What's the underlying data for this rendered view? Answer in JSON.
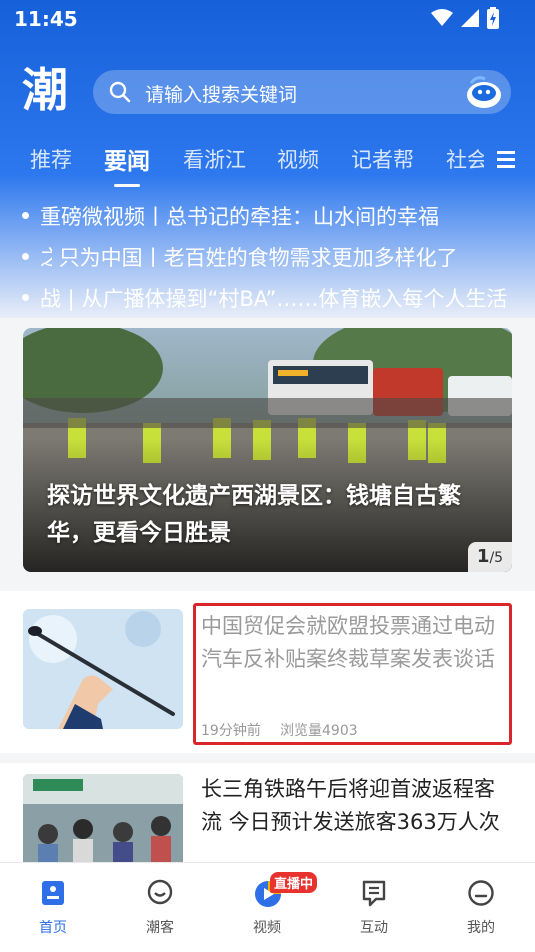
{
  "status": {
    "time": "11:45"
  },
  "header": {
    "logo_text": "潮",
    "search_placeholder": "请输入搜索关键词"
  },
  "tabs": [
    {
      "label": "推荐"
    },
    {
      "label": "要闻",
      "active": true
    },
    {
      "label": "看浙江"
    },
    {
      "label": "视频"
    },
    {
      "label": "记者帮"
    },
    {
      "label": "社会"
    }
  ],
  "headlines": [
    "重磅微视频丨总书记的牵挂：山水间的幸福",
    "只为中国丨老百姓的食物需求更加多样化了",
    "从广播体操到“村BA”……体育嵌入每个人生活"
  ],
  "headline_prefixes": [
    "",
    "之",
    "战 |"
  ],
  "banner": {
    "title": "探访世界文化遗产西湖景区：钱塘自古繁华，更看今日胜景",
    "page_current": "1",
    "page_total": "/5"
  },
  "articles": [
    {
      "title": "中国贸促会就欧盟投票通过电动汽车反补贴案终裁草案发表谈话",
      "time": "19分钟前",
      "views": "浏览量4903"
    },
    {
      "title": "长三角铁路午后将迎首波返程客流 今日预计发送旅客363万人次"
    }
  ],
  "bottom_nav": [
    {
      "label": "首页",
      "icon": "home-icon",
      "active": true
    },
    {
      "label": "潮客",
      "icon": "chat-icon"
    },
    {
      "label": "视频",
      "icon": "video-icon",
      "badge": "直播中"
    },
    {
      "label": "互动",
      "icon": "interact-icon"
    },
    {
      "label": "我的",
      "icon": "profile-icon"
    }
  ],
  "colors": {
    "primary": "#1660d9",
    "active_nav": "#2f6fe8",
    "highlight": "#d9262c",
    "live_badge": "#e8322e"
  }
}
